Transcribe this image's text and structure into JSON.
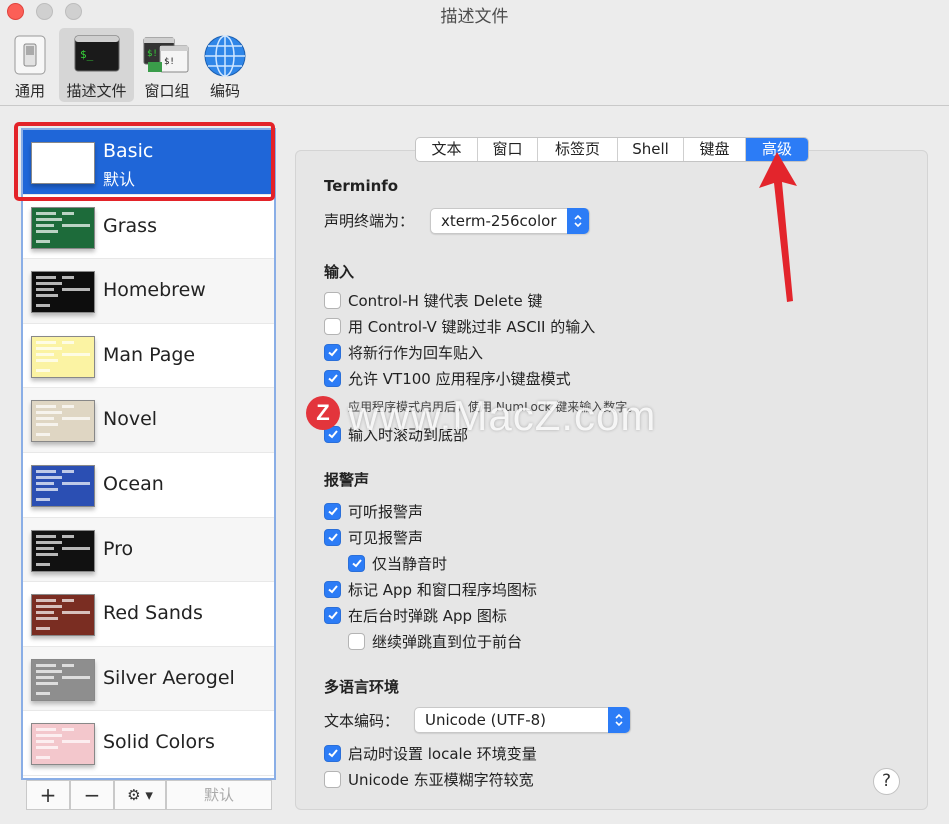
{
  "window": {
    "title": "描述文件"
  },
  "toolbar": {
    "items": [
      {
        "label": "通用",
        "icon": "switch-icon"
      },
      {
        "label": "描述文件",
        "icon": "terminal-icon"
      },
      {
        "label": "窗口组",
        "icon": "window-group-icon"
      },
      {
        "label": "编码",
        "icon": "globe-icon"
      }
    ]
  },
  "profiles": [
    {
      "name": "Basic",
      "sub": "默认",
      "color": "#ffffff",
      "selected": true
    },
    {
      "name": "Grass",
      "color": "#1d6b3a"
    },
    {
      "name": "Homebrew",
      "color": "#0d0d0d"
    },
    {
      "name": "Man Page",
      "color": "#fbf3a3"
    },
    {
      "name": "Novel",
      "color": "#dfd6c3"
    },
    {
      "name": "Ocean",
      "color": "#2b4fb3"
    },
    {
      "name": "Pro",
      "color": "#111111"
    },
    {
      "name": "Red Sands",
      "color": "#7a2d22"
    },
    {
      "name": "Silver Aerogel",
      "color": "#8e8e8e"
    },
    {
      "name": "Solid Colors",
      "color": "#f3c7cc"
    }
  ],
  "bottom": {
    "add": "+",
    "remove": "−",
    "gear": "⚙ ▾",
    "default": "默认"
  },
  "tabs": [
    "文本",
    "窗口",
    "标签页",
    "Shell",
    "键盘",
    "高级"
  ],
  "terminfo": {
    "header": "Terminfo",
    "label": "声明终端为：",
    "value": "xterm-256color"
  },
  "input": {
    "header": "输入",
    "options": [
      {
        "label": "Control-H 键代表 Delete 键",
        "checked": false
      },
      {
        "label": "用 Control-V 键跳过非 ASCII 的输入",
        "checked": false
      },
      {
        "label": "将新行作为回车贴入",
        "checked": true
      },
      {
        "label": "允许 VT100 应用程序小键盘模式",
        "checked": true
      },
      {
        "label": "输入时滚动到底部",
        "checked": true
      }
    ],
    "note": "应用程序模式启用后，使用 NumLock 键来输入数字。"
  },
  "bell": {
    "header": "报警声",
    "options": [
      {
        "label": "可听报警声",
        "checked": true
      },
      {
        "label": "可见报警声",
        "checked": true
      },
      {
        "label": "仅当静音时",
        "checked": true
      },
      {
        "label": "标记 App 和窗口程序坞图标",
        "checked": true
      },
      {
        "label": "在后台时弹跳 App 图标",
        "checked": true
      },
      {
        "label": "继续弹跳直到位于前台",
        "checked": false
      }
    ]
  },
  "intl": {
    "header": "多语言环境",
    "encoding_label": "文本编码：",
    "encoding_value": "Unicode (UTF-8)",
    "options": [
      {
        "label": "启动时设置 locale 环境变量",
        "checked": true
      },
      {
        "label": "Unicode 东亚模糊字符较宽",
        "checked": false
      }
    ]
  },
  "help": "?",
  "watermark": {
    "text": "www.MacZ.com",
    "logo": "Z"
  }
}
